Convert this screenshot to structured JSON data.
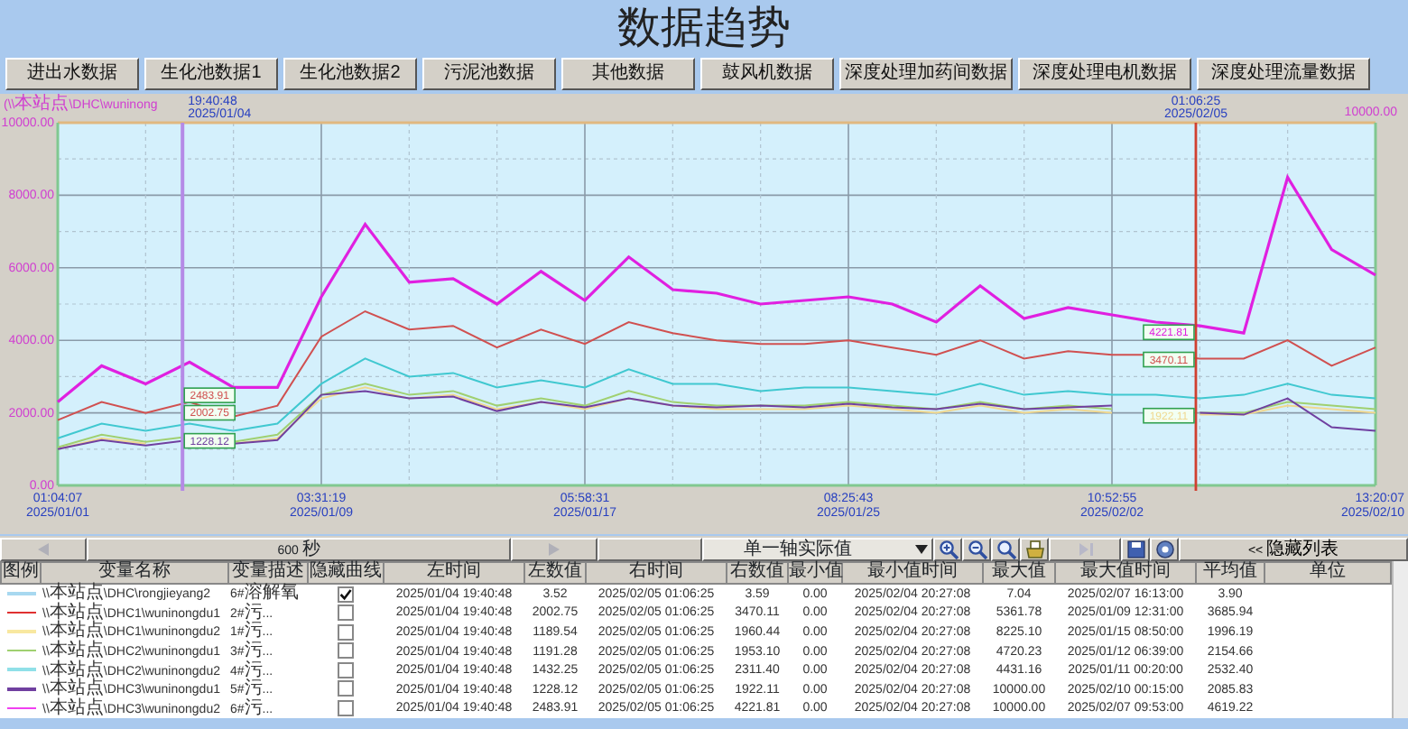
{
  "page_title": "数据趋势",
  "nav_buttons": [
    "进出水数据",
    "生化池数据1",
    "生化池数据2",
    "污泥池数据",
    "其他数据",
    "鼓风机数据",
    "深度处理加药间数据",
    "深度处理电机数据",
    "深度处理流量数据"
  ],
  "chart": {
    "chart_data": {
      "type": "line",
      "title": "(\\\\本站点\\DHC\\wuninong",
      "ylim": [
        0,
        10000
      ],
      "yticks": [
        {
          "value": 0,
          "label": "0.00"
        },
        {
          "value": 2000,
          "label": "2000.00"
        },
        {
          "value": 4000,
          "label": "4000.00"
        },
        {
          "value": 6000,
          "label": "6000.00"
        },
        {
          "value": 8000,
          "label": "8000.00"
        },
        {
          "value": 10000,
          "label": "10000.00"
        }
      ],
      "categories": [
        "01:04:07 2025/01/01",
        null,
        null,
        null,
        null,
        null,
        "03:31:19 2025/01/09",
        null,
        null,
        null,
        null,
        null,
        "05:58:31 2025/01/17",
        null,
        null,
        null,
        null,
        null,
        "08:25:43 2025/01/25",
        null,
        null,
        null,
        null,
        null,
        "10:52:55 2025/02/02",
        null,
        null,
        null,
        null,
        null,
        "13:20:07 2025/02/10"
      ],
      "series": [
        {
          "color": "#e020e0",
          "values": [
            2300,
            3300,
            2800,
            3400,
            2700,
            2700,
            5200,
            7200,
            5600,
            5700,
            5000,
            5900,
            5100,
            6300,
            5400,
            5300,
            5000,
            5100,
            5200,
            5000,
            4500,
            5500,
            4600,
            4900,
            4700,
            4500,
            4400,
            4200,
            8500,
            6500,
            5800
          ]
        },
        {
          "color": "#d05050",
          "values": [
            1800,
            2300,
            2000,
            2300,
            1900,
            2200,
            4100,
            4800,
            4300,
            4400,
            3800,
            4300,
            3900,
            4500,
            4200,
            4000,
            3900,
            3900,
            4000,
            3800,
            3600,
            4000,
            3500,
            3700,
            3600,
            3600,
            3500,
            3500,
            4000,
            3300,
            3800
          ]
        },
        {
          "color": "#40c8d0",
          "values": [
            1300,
            1700,
            1500,
            1700,
            1500,
            1700,
            2800,
            3500,
            3000,
            3100,
            2700,
            2900,
            2700,
            3200,
            2800,
            2800,
            2600,
            2700,
            2700,
            2600,
            2500,
            2800,
            2500,
            2600,
            2500,
            2500,
            2400,
            2500,
            2800,
            2500,
            2400
          ]
        },
        {
          "color": "#a0d070",
          "values": [
            1050,
            1400,
            1200,
            1350,
            1200,
            1400,
            2500,
            2800,
            2500,
            2600,
            2200,
            2400,
            2200,
            2600,
            2300,
            2200,
            2200,
            2200,
            2300,
            2200,
            2100,
            2300,
            2100,
            2200,
            2100,
            null,
            2000,
            2000,
            2300,
            2200,
            2100
          ]
        },
        {
          "color": "#f0d890",
          "values": [
            1000,
            1300,
            1150,
            null,
            1150,
            1300,
            2400,
            2700,
            2400,
            2500,
            2100,
            2300,
            2100,
            2400,
            2200,
            2100,
            2100,
            2100,
            2200,
            2100,
            2000,
            2200,
            2000,
            2100,
            2000,
            null,
            1950,
            1950,
            2200,
            2100,
            2000
          ]
        },
        {
          "color": "#7040a0",
          "values": [
            1000,
            1250,
            1100,
            1250,
            1150,
            1250,
            2500,
            2600,
            2400,
            2450,
            2050,
            2300,
            2150,
            2400,
            2200,
            2150,
            2200,
            2150,
            2250,
            2150,
            2100,
            2250,
            2100,
            2150,
            2200,
            null,
            2000,
            1950,
            2400,
            1600,
            1500
          ]
        }
      ],
      "grid": true
    },
    "cursors": [
      {
        "time": "19:40:48",
        "date": "2025/01/04",
        "color": "#b58ae6",
        "values": [
          "2483.91",
          "2002.75",
          "1228.12"
        ]
      },
      {
        "time": "01:06:25",
        "date": "2025/02/05",
        "color": "#d04030",
        "values": [
          "4221.81",
          "3470.11",
          "1922.11"
        ]
      }
    ],
    "right_axis_label": "10000.00"
  },
  "toolbar": {
    "time_span": "600 秒",
    "axis_mode": "单一轴实际值",
    "play_disabled": true,
    "hide_list_button": "<< 隐藏列表"
  },
  "table": {
    "columns": [
      "图例",
      "变量名称",
      "变量描述",
      "隐藏曲线",
      "左时间",
      "左数值",
      "右时间",
      "右数值",
      "最小值",
      "最小值时间",
      "最大值",
      "最大值时间",
      "平均值",
      "单位"
    ],
    "rows": [
      {
        "color": "#a8d8f0",
        "name": "\\\\本站点\\DHC\\rongjieyang2",
        "description": "6#溶解氧",
        "hidden": true,
        "left_time": "2025/01/04 19:40:48",
        "left_value": "3.52",
        "right_time": "2025/02/05 01:06:25",
        "right_value": "3.59",
        "min": "0.00",
        "min_time": "2025/02/04 20:27:08",
        "max": "7.04",
        "max_time": "2025/02/07 16:13:00",
        "average": "3.90"
      },
      {
        "color": "#e03030",
        "name": "\\\\本站点\\DHC1\\wuninongdu1",
        "description": "2#污...",
        "hidden": false,
        "left_time": "2025/01/04 19:40:48",
        "left_value": "2002.75",
        "right_time": "2025/02/05 01:06:25",
        "right_value": "3470.11",
        "min": "0.00",
        "min_time": "2025/02/04 20:27:08",
        "max": "5361.78",
        "max_time": "2025/01/09 12:31:00",
        "average": "3685.94"
      },
      {
        "color": "#f8e8a0",
        "name": "\\\\本站点\\DHC1\\wuninongdu2",
        "description": "1#污...",
        "hidden": false,
        "left_time": "2025/01/04 19:40:48",
        "left_value": "1189.54",
        "right_time": "2025/02/05 01:06:25",
        "right_value": "1960.44",
        "min": "0.00",
        "min_time": "2025/02/04 20:27:08",
        "max": "8225.10",
        "max_time": "2025/01/15 08:50:00",
        "average": "1996.19"
      },
      {
        "color": "#a0d070",
        "name": "\\\\本站点\\DHC2\\wuninongdu1",
        "description": "3#污...",
        "hidden": false,
        "left_time": "2025/01/04 19:40:48",
        "left_value": "1191.28",
        "right_time": "2025/02/05 01:06:25",
        "right_value": "1953.10",
        "min": "0.00",
        "min_time": "2025/02/04 20:27:08",
        "max": "4720.23",
        "max_time": "2025/01/12 06:39:00",
        "average": "2154.66"
      },
      {
        "color": "#90e0e8",
        "name": "\\\\本站点\\DHC2\\wuninongdu2",
        "description": "4#污...",
        "hidden": false,
        "left_time": "2025/01/04 19:40:48",
        "left_value": "1432.25",
        "right_time": "2025/02/05 01:06:25",
        "right_value": "2311.40",
        "min": "0.00",
        "min_time": "2025/02/04 20:27:08",
        "max": "4431.16",
        "max_time": "2025/01/11 00:20:00",
        "average": "2532.40"
      },
      {
        "color": "#7040a0",
        "name": "\\\\本站点\\DHC3\\wuninongdu1",
        "description": "5#污...",
        "hidden": false,
        "left_time": "2025/01/04 19:40:48",
        "left_value": "1228.12",
        "right_time": "2025/02/05 01:06:25",
        "right_value": "1922.11",
        "min": "0.00",
        "min_time": "2025/02/04 20:27:08",
        "max": "10000.00",
        "max_time": "2025/02/10 00:15:00",
        "average": "2085.83"
      },
      {
        "color": "#f040f0",
        "name": "\\\\本站点\\DHC3\\wuninongdu2",
        "description": "6#污...",
        "hidden": false,
        "left_time": "2025/01/04 19:40:48",
        "left_value": "2483.91",
        "right_time": "2025/02/05 01:06:25",
        "right_value": "4221.81",
        "min": "0.00",
        "min_time": "2025/02/04 20:27:08",
        "max": "10000.00",
        "max_time": "2025/02/07 09:53:00",
        "average": "4619.22"
      }
    ]
  }
}
